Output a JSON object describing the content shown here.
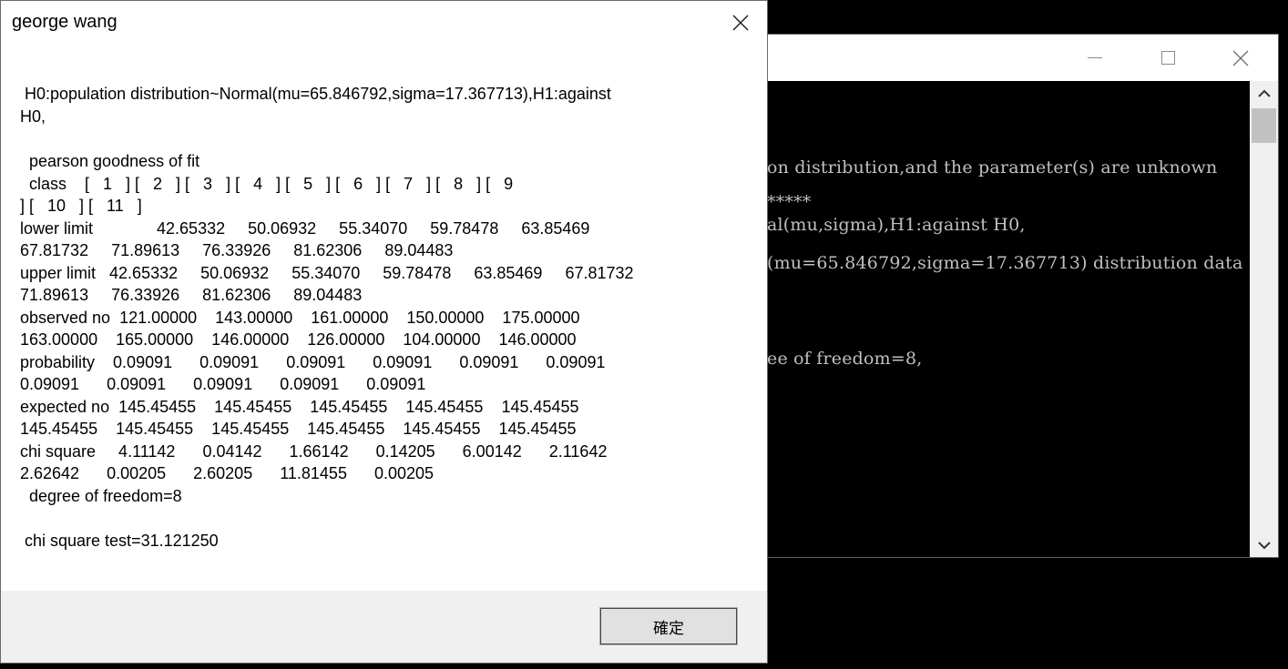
{
  "console": {
    "lines": [
      "on distribution,and the parameter(s) are unknown",
      "*****",
      "al(mu,sigma),H1:against H0,",
      "(mu=65.846792,sigma=17.367713) distribution data",
      "ee of freedom=8,"
    ]
  },
  "dialog": {
    "title": "george wang",
    "lines": [
      " H0:population distribution~Normal(mu=65.846792,sigma=17.367713),H1:against",
      "H0,",
      "",
      "  pearson goodness of fit",
      "  class    [   1   ] [   2   ] [   3   ] [   4   ] [   5   ] [   6   ] [   7   ] [   8   ] [   9",
      "] [   10   ] [   11   ]",
      "lower limit              42.65332     50.06932     55.34070     59.78478     63.85469",
      "67.81732     71.89613     76.33926     81.62306     89.04483",
      "upper limit   42.65332     50.06932     55.34070     59.78478     63.85469     67.81732",
      "71.89613     76.33926     81.62306     89.04483",
      "observed no  121.00000    143.00000    161.00000    150.00000    175.00000",
      "163.00000    165.00000    146.00000    126.00000    104.00000    146.00000",
      "probability    0.09091      0.09091      0.09091      0.09091      0.09091      0.09091",
      "0.09091      0.09091      0.09091      0.09091      0.09091",
      "expected no  145.45455    145.45455    145.45455    145.45455    145.45455",
      "145.45455    145.45455    145.45455    145.45455    145.45455    145.45455",
      "chi square     4.11142      0.04142      1.66142      0.14205      6.00142      2.11642",
      "2.62642      0.00205      2.60205      11.81455      0.00205",
      "  degree of freedom=8",
      "",
      " chi square test=31.121250"
    ],
    "ok_label": "確定"
  },
  "icons": {
    "close": "close-icon",
    "minimize": "minimize-icon",
    "maximize": "maximize-icon",
    "scroll_up": "chevron-up-icon",
    "scroll_down": "chevron-down-icon"
  },
  "colors": {
    "console_background": "#000000",
    "console_text": "#c0c0c0",
    "dialog_background": "#ffffff",
    "dialog_footer": "#f0f0f0",
    "button_face": "#e1e1e1"
  }
}
